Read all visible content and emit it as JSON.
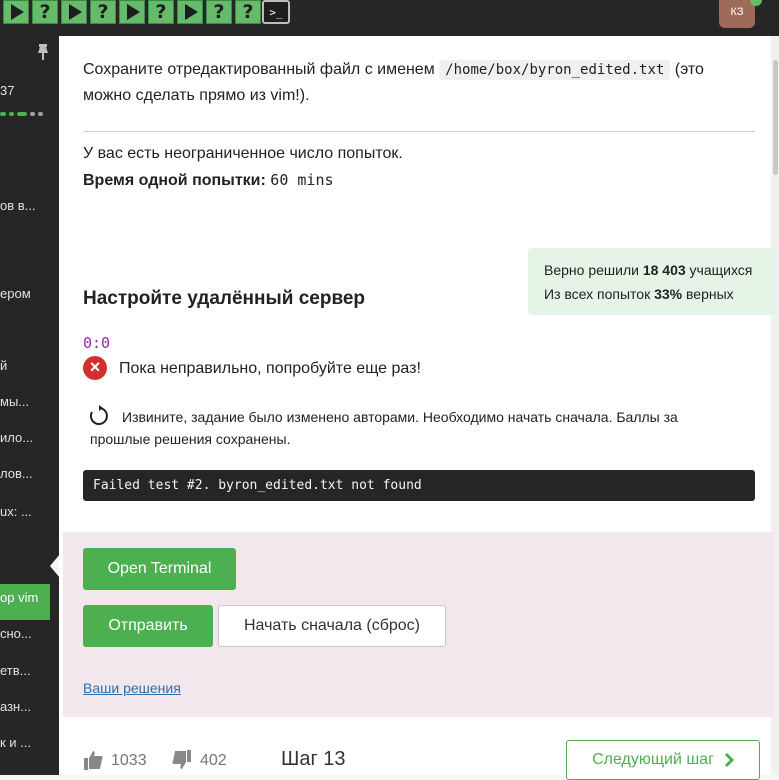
{
  "topbar": {
    "steps": [
      {
        "type": "play",
        "icon": "play-icon"
      },
      {
        "type": "question",
        "label": "?"
      },
      {
        "type": "play",
        "icon": "play-icon"
      },
      {
        "type": "question",
        "label": "?"
      },
      {
        "type": "play",
        "icon": "play-icon"
      },
      {
        "type": "question",
        "label": "?"
      },
      {
        "type": "play",
        "icon": "play-icon"
      },
      {
        "type": "question",
        "label": "?"
      },
      {
        "type": "question",
        "label": "?"
      }
    ],
    "terminal_label": ">_",
    "user_initials": "КЗ"
  },
  "sidebar": {
    "score": "37",
    "items": [
      "ов в...",
      "ером",
      "й",
      "мы...",
      "ило...",
      "лов...",
      "ux: ...",
      "ор vim",
      "сно...",
      "етв...",
      "азн...",
      "к и ..."
    ],
    "active_index": 7
  },
  "content": {
    "save_text_before": "Сохраните отредактированный файл с именем",
    "save_path": "/home/box/byron_edited.txt",
    "save_text_after_1": "(это",
    "save_text_after_2": "можно сделать прямо из vim!).",
    "attempts_text": "У вас есть неограниченное число попыток.",
    "attempt_time_label": "Время одной попытки:",
    "attempt_time_value": "60 mins",
    "stats": {
      "solved_prefix": "Верно решили",
      "solved_count": "18 403",
      "solved_suffix": "учащихся",
      "attempts_prefix": "Из всех попыток",
      "attempts_percent": "33%",
      "attempts_suffix": "верных"
    },
    "task_title": "Настройте удалённый сервер",
    "timer": "0:0",
    "wrong_message": "Пока неправильно, попробуйте еще раз!",
    "reset_note": "Извините, задание было изменено авторами. Необходимо начать сначала. Баллы за прошлые решения сохранены.",
    "error_output": "Failed test #2. byron_edited.txt not found"
  },
  "actions": {
    "open_terminal": "Open Terminal",
    "submit": "Отправить",
    "reset": "Начать сначала (сброс)",
    "my_solutions": "Ваши решения"
  },
  "footer": {
    "likes": "1033",
    "dislikes": "402",
    "step": "Шаг 13",
    "next_step": "Следующий шаг"
  },
  "colors": {
    "accent_green": "#4caf50",
    "error_red": "#d32f2f",
    "timer_purple": "#9b25af",
    "stats_bg": "#e6f4e7",
    "actions_bg": "#f2e7ec"
  }
}
